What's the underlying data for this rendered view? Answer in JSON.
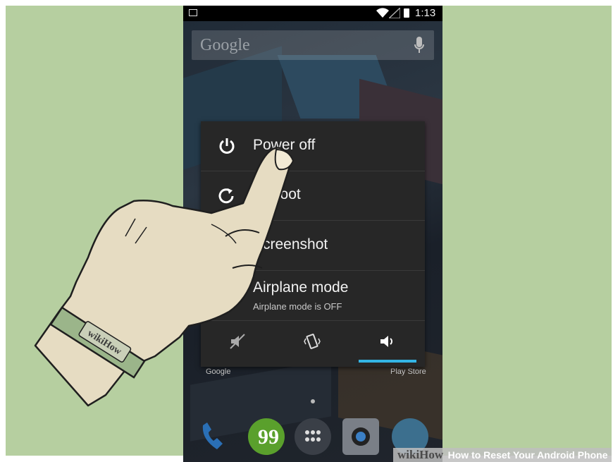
{
  "status_bar": {
    "time": "1:13"
  },
  "search": {
    "brand": "Google"
  },
  "power_menu": {
    "items": [
      {
        "label": "Power off",
        "icon": "power-icon"
      },
      {
        "label": "Reboot",
        "icon": "reboot-icon"
      },
      {
        "label": "Screenshot",
        "icon": "camera-icon"
      },
      {
        "label": "Airplane mode",
        "sublabel": "Airplane mode is OFF",
        "icon": "airplane-icon"
      }
    ],
    "sound_modes": [
      "silent-icon",
      "vibrate-icon",
      "sound-on-icon"
    ],
    "active_sound_mode": "sound-on-icon",
    "accent": "#33b5e5"
  },
  "home": {
    "left_label": "Google",
    "right_label": "Play Store"
  },
  "banner": {
    "logo": "wikiHow",
    "title": "How to Reset Your Android Phone"
  },
  "wristband": {
    "logo": "wikiHow"
  }
}
